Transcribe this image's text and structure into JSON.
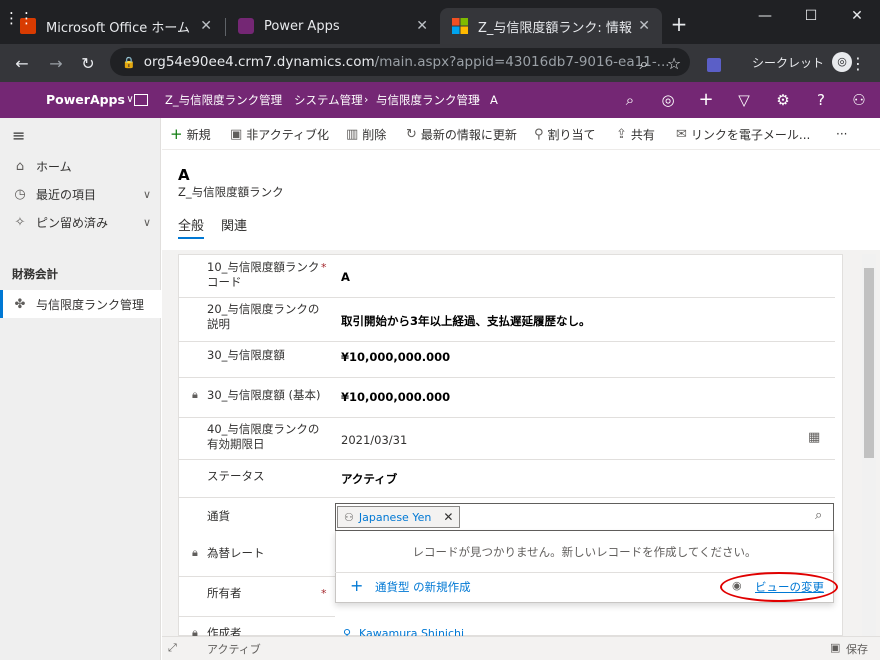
{
  "browser": {
    "tabs": [
      {
        "title": "Microsoft Office ホーム",
        "close": "✕"
      },
      {
        "title": "Power Apps",
        "close": "✕"
      },
      {
        "title": "Z_与信限度額ランク: 情報（全",
        "close": "✕"
      }
    ],
    "new_tab": "+",
    "window_controls": [
      "—",
      "☐",
      "✕"
    ],
    "url_host": "org54e90ee4.crm7.dynamics.com",
    "url_path": "/main.aspx?appid=43016db7-9016-ea11-...",
    "incognito_label": "シークレット"
  },
  "app_header": {
    "app_name": "PowerApps",
    "breadcrumb": [
      "Z_与信限度ランク管理",
      "システム管理",
      "与信限度ランク管理",
      "A"
    ]
  },
  "left_nav": {
    "items": [
      {
        "label": "ホーム",
        "icon": "home-icon"
      },
      {
        "label": "最近の項目",
        "icon": "clock-icon"
      },
      {
        "label": "ピン留め済み",
        "icon": "pin-icon"
      }
    ],
    "section_title": "財務会計",
    "section_items": [
      {
        "label": "与信限度ランク管理",
        "icon": "puzzle-icon"
      }
    ]
  },
  "command_bar": {
    "commands": [
      {
        "label": "新規",
        "icon": "plus-icon"
      },
      {
        "label": "非アクティブ化",
        "icon": "deactivate-icon"
      },
      {
        "label": "削除",
        "icon": "trash-icon"
      },
      {
        "label": "最新の情報に更新",
        "icon": "refresh-icon"
      },
      {
        "label": "割り当て",
        "icon": "assign-icon"
      },
      {
        "label": "共有",
        "icon": "share-icon"
      },
      {
        "label": "リンクを電子メール...",
        "icon": "email-icon"
      }
    ],
    "more": "···"
  },
  "record": {
    "title": "A",
    "entity": "Z_与信限度額ランク",
    "tabs": [
      "全般",
      "関連"
    ]
  },
  "form": {
    "fields": [
      {
        "label_lines": [
          "10_与信限度額ランク",
          "コード"
        ],
        "value": "A",
        "required": true,
        "locked": false
      },
      {
        "label_lines": [
          "20_与信限度ランクの",
          "説明"
        ],
        "value": "取引開始から3年以上経過、支払遅延履歴なし。",
        "required": false,
        "locked": false
      },
      {
        "label_lines": [
          "30_与信限度額"
        ],
        "value": "¥10,000,000.000",
        "required": false,
        "locked": false
      },
      {
        "label_lines": [
          "30_与信限度額 (基本)"
        ],
        "value": "¥10,000,000.000",
        "required": false,
        "locked": true
      },
      {
        "label_lines": [
          "40_与信限度ランクの",
          "有効期限日"
        ],
        "value": "2021/03/31",
        "required": false,
        "locked": false
      },
      {
        "label_lines": [
          "ステータス"
        ],
        "value": "アクティブ",
        "required": false,
        "locked": false
      },
      {
        "label_lines": [
          "通貨"
        ],
        "value": "",
        "required": false,
        "locked": false
      },
      {
        "label_lines": [
          "為替レート"
        ],
        "value": "",
        "required": false,
        "locked": true
      },
      {
        "label_lines": [
          "所有者"
        ],
        "value": "",
        "required": true,
        "locked": false
      },
      {
        "label_lines": [
          "作成者"
        ],
        "value": "Kawamura Shinichi",
        "required": false,
        "locked": true
      }
    ],
    "required_mark": "*",
    "currency_tag": "Japanese Yen",
    "lookup_no_records": "レコードが見つかりません。新しいレコードを作成してください。",
    "lookup_new": "通貨型 の新規作成",
    "lookup_change_view": "ビューの変更"
  },
  "status_bar": {
    "status": "アクティブ",
    "save": "保存"
  }
}
